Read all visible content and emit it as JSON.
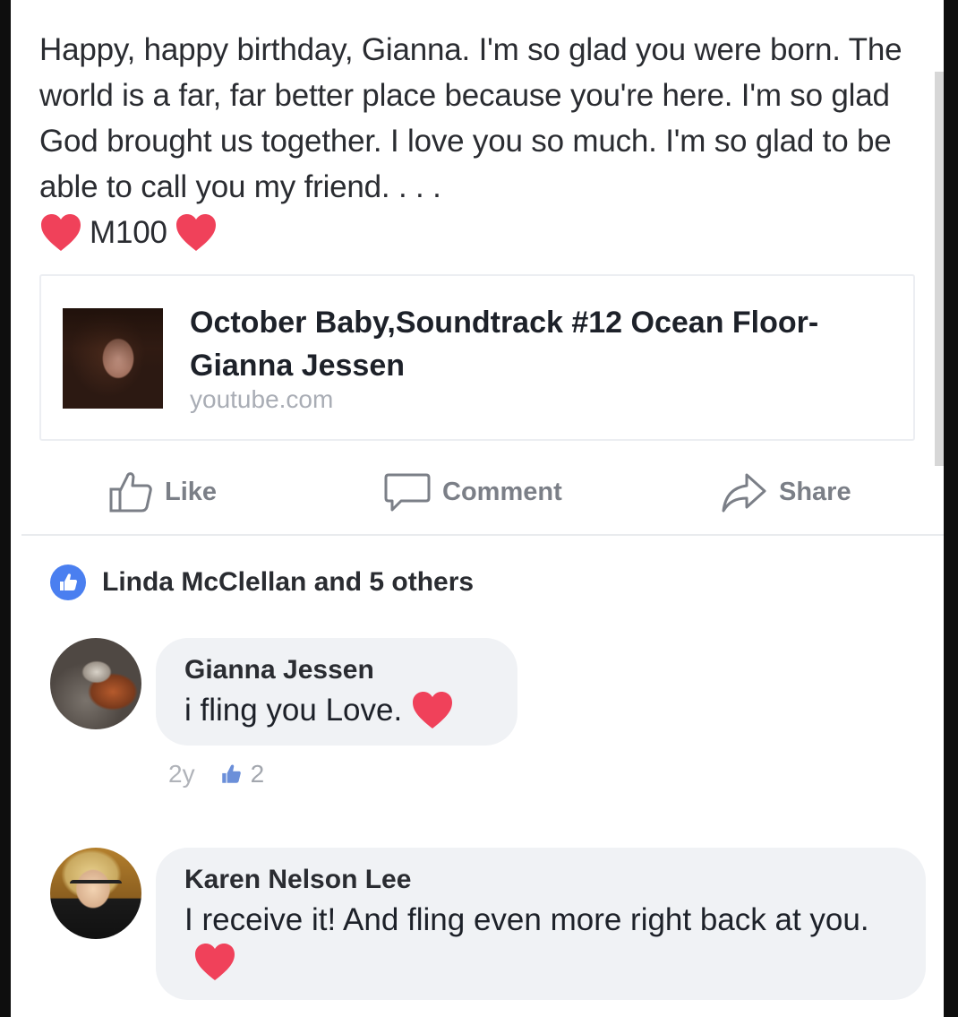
{
  "post": {
    "body": "Happy, happy birthday, Gianna. I'm so glad you were born. The world is a far, far better place because you're here. I'm so glad God brought us together. I love you so much. I'm so glad to be able to call you my friend. . . .",
    "signature": "M100"
  },
  "link_card": {
    "title": "October Baby,Soundtrack #12 Ocean Floor-Gianna Jessen",
    "domain": "youtube.com"
  },
  "actions": {
    "like_label": "Like",
    "comment_label": "Comment",
    "share_label": "Share"
  },
  "reactions": {
    "summary": "Linda McClellan and 5 others"
  },
  "comments": [
    {
      "author": "Gianna Jessen",
      "text": "i fling you Love.",
      "age": "2y",
      "like_count": "2"
    },
    {
      "author": "Karen Nelson Lee",
      "text": "I receive it! And fling even more right back at you."
    }
  ],
  "colors": {
    "heart": "#f0415a",
    "like_blue": "#4a7ff0",
    "bubble_bg": "#f0f2f5",
    "muted_text": "#7b7f87"
  }
}
